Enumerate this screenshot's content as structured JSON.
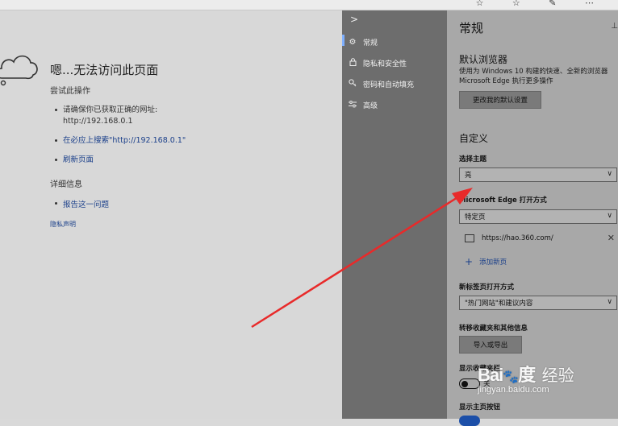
{
  "error_page": {
    "title": "嗯...无法访问此页面",
    "try_label": "尝试此操作",
    "bullet_check_line1": "请确保你已获取正确的网址:",
    "bullet_check_line2": "http://192.168.0.1",
    "bullet_search": "在必应上搜索\"http://192.168.0.1\"",
    "bullet_refresh": "刷新页面",
    "details_label": "详细信息",
    "report_link": "报告这一问题",
    "privacy_link": "隐私声明"
  },
  "nav": {
    "toggle": ">",
    "items": [
      {
        "label": "常规",
        "icon": "gear-icon"
      },
      {
        "label": "隐私和安全性",
        "icon": "lock-icon"
      },
      {
        "label": "密码和自动填充",
        "icon": "key-icon"
      },
      {
        "label": "高级",
        "icon": "sliders-icon"
      }
    ]
  },
  "settings": {
    "title": "常规",
    "default_browser_heading": "默认浏览器",
    "default_browser_desc": "使用为 Windows 10 构建的快速、全新的浏览器 Microsoft Edge 执行更多操作",
    "change_default_button": "更改我的默认设置",
    "customize_heading": "自定义",
    "theme_label": "选择主题",
    "theme_value": "亮",
    "open_with_label": "Microsoft Edge 打开方式",
    "open_with_value": "特定页",
    "specific_page_url": "https://hao.360.com/",
    "add_page": "添加新页",
    "new_tab_label": "新标签页打开方式",
    "new_tab_value": "\"热门网站\"和建议内容",
    "transfer_label": "转移收藏夹和其他信息",
    "import_export_button": "导入或导出",
    "show_favorites_bar_label": "显示收藏夹栏",
    "favorites_bar_state": "关",
    "show_home_button_label": "显示主页按钮"
  },
  "watermark": {
    "logo": "Bai",
    "logo_tail": "度",
    "jingyan": "经验",
    "url": "jingyan.baidu.com"
  },
  "annotation_arrow_color": "#e82a2a"
}
